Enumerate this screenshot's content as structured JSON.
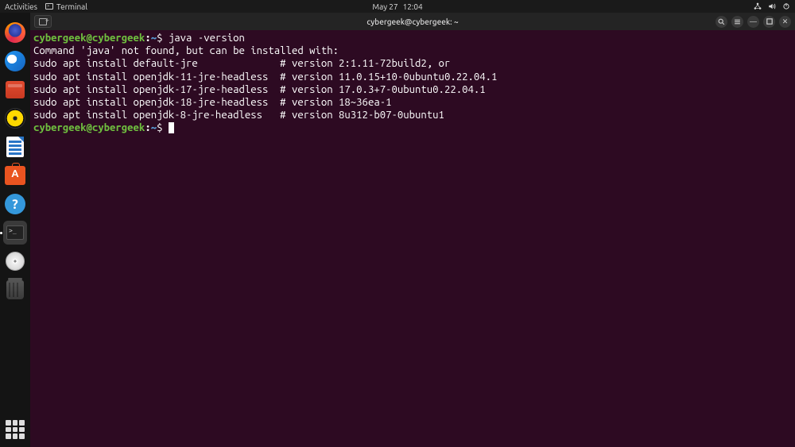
{
  "topbar": {
    "activities": "Activities",
    "app_name": "Terminal",
    "date": "May 27",
    "time": "12:04"
  },
  "dock": {
    "items": [
      {
        "name": "firefox",
        "active": false
      },
      {
        "name": "thunderbird",
        "active": false
      },
      {
        "name": "files",
        "active": false
      },
      {
        "name": "rhythmbox",
        "active": false
      },
      {
        "name": "libreoffice-writer",
        "active": false
      },
      {
        "name": "ubuntu-software",
        "active": false
      },
      {
        "name": "help",
        "active": false
      },
      {
        "name": "terminal",
        "active": true
      },
      {
        "name": "disc",
        "active": false
      },
      {
        "name": "trash",
        "active": false
      }
    ]
  },
  "window": {
    "title": "cybergeek@cybergeek: ~"
  },
  "terminal": {
    "prompt_user": "cybergeek@cybergeek",
    "prompt_path": "~",
    "command1": "java -version",
    "output": {
      "line1": "Command 'java' not found, but can be installed with:",
      "line2": "sudo apt install default-jre              # version 2:1.11-72build2, or",
      "line3": "sudo apt install openjdk-11-jre-headless  # version 11.0.15+10-0ubuntu0.22.04.1",
      "line4": "sudo apt install openjdk-17-jre-headless  # version 17.0.3+7-0ubuntu0.22.04.1",
      "line5": "sudo apt install openjdk-18-jre-headless  # version 18~36ea-1",
      "line6": "sudo apt install openjdk-8-jre-headless   # version 8u312-b07-0ubuntu1"
    }
  }
}
